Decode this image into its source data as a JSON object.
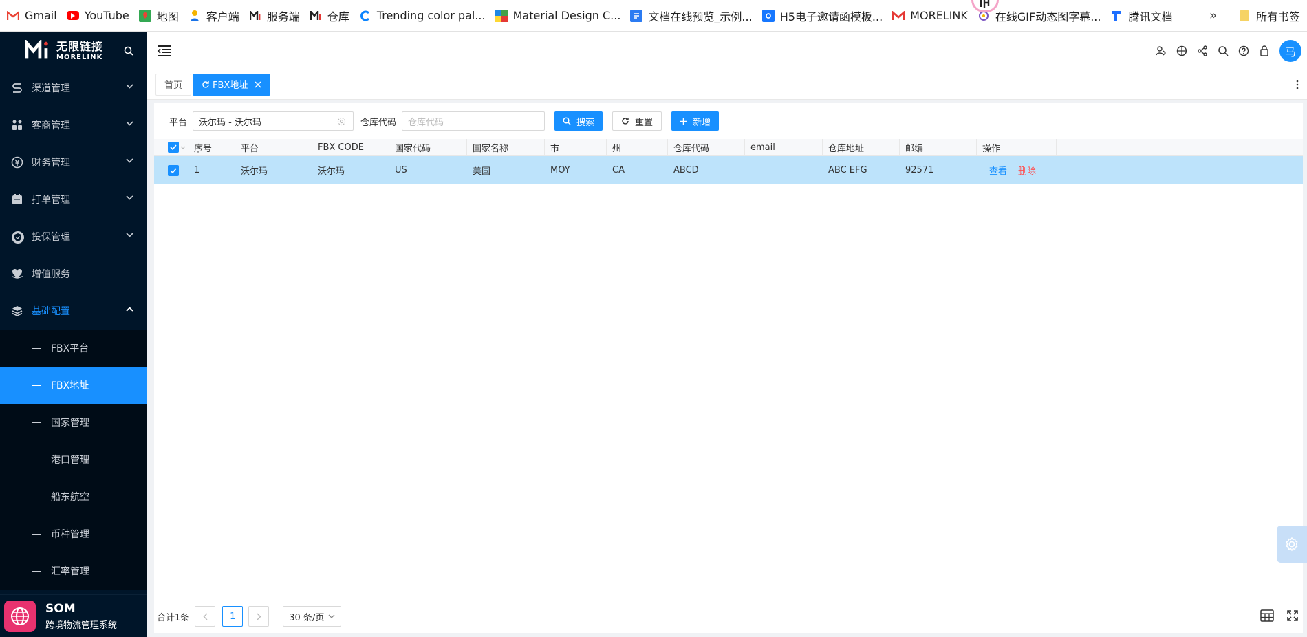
{
  "bookmarks": [
    {
      "label": "Gmail",
      "icon": "gmail-icon",
      "color": "#ea4335"
    },
    {
      "label": "YouTube",
      "icon": "youtube-icon",
      "color": "#ff0000"
    },
    {
      "label": "地图",
      "icon": "maps-icon",
      "color": "#34a853"
    },
    {
      "label": "客户端",
      "icon": "client-icon",
      "color": "#1a73e8"
    },
    {
      "label": "服务端",
      "icon": "morelink-icon",
      "color": "#333333"
    },
    {
      "label": "仓库",
      "icon": "morelink-icon",
      "color": "#333333"
    },
    {
      "label": "Trending color pal...",
      "icon": "coolors-icon",
      "color": "#0a84ff"
    },
    {
      "label": "Material Design C...",
      "icon": "material-icon",
      "color": "#1e88e5"
    },
    {
      "label": "文档在线预览_示例...",
      "icon": "doc-icon",
      "color": "#2b7bf2"
    },
    {
      "label": "H5电子邀请函模板...",
      "icon": "h5-icon",
      "color": "#1677ff"
    },
    {
      "label": "MORELINK",
      "icon": "gmail-icon",
      "color": "#e53935"
    },
    {
      "label": "在线GIF动态图字幕...",
      "icon": "gif-icon",
      "color": "#7e57c2"
    },
    {
      "label": "腾讯文档",
      "icon": "tencent-doc-icon",
      "color": "#1e6fff"
    }
  ],
  "bookmarks_more": "»",
  "bookmarks_folder": "所有书签",
  "brand": {
    "cn": "无限链接",
    "en": "MORELINK"
  },
  "sidebar": {
    "items": [
      {
        "label": "渠道管理",
        "icon": "channel-icon"
      },
      {
        "label": "客商管理",
        "icon": "merchant-icon"
      },
      {
        "label": "财务管理",
        "icon": "yen-icon"
      },
      {
        "label": "打单管理",
        "icon": "print-order-icon"
      },
      {
        "label": "投保管理",
        "icon": "insurance-icon"
      },
      {
        "label": "增值服务",
        "icon": "value-added-icon"
      },
      {
        "label": "基础配置",
        "icon": "layers-icon"
      }
    ],
    "sub_items": [
      {
        "label": "FBX平台"
      },
      {
        "label": "FBX地址"
      },
      {
        "label": "国家管理"
      },
      {
        "label": "港口管理"
      },
      {
        "label": "船东航空"
      },
      {
        "label": "币种管理"
      },
      {
        "label": "汇率管理"
      }
    ],
    "selected_sub": "FBX地址",
    "footer": {
      "title": "SOM",
      "subtitle": "跨境物流管理系统"
    }
  },
  "header": {
    "avatar_text": "马"
  },
  "tabs": [
    {
      "label": "首页"
    },
    {
      "label": "FBX地址"
    }
  ],
  "filters": {
    "platform_label": "平台",
    "platform_value": "沃尔玛 - 沃尔玛",
    "warehouse_label": "仓库代码",
    "warehouse_placeholder": "仓库代码",
    "search_label": "搜索",
    "reset_label": "重置",
    "add_label": "新增"
  },
  "table": {
    "columns": [
      "序号",
      "平台",
      "FBX CODE",
      "国家代码",
      "国家名称",
      "市",
      "州",
      "仓库代码",
      "email",
      "仓库地址",
      "邮编",
      "操作"
    ],
    "rows": [
      {
        "index": "1",
        "platform": "沃尔玛",
        "fbx_code": "沃尔玛",
        "country_code": "US",
        "country_name": "美国",
        "city": "MOY",
        "state": "CA",
        "warehouse_code": "ABCD",
        "email": "",
        "address": "ABC EFG",
        "zip": "92571",
        "view": "查看",
        "delete": "删除"
      }
    ]
  },
  "pager": {
    "total": "合计1条",
    "page": "1",
    "page_size": "30 条/页"
  },
  "colors": {
    "primary": "#1890ff",
    "sidebar_bg": "#001529",
    "row_selected": "#bde3fb",
    "danger": "#ff4d4f"
  }
}
